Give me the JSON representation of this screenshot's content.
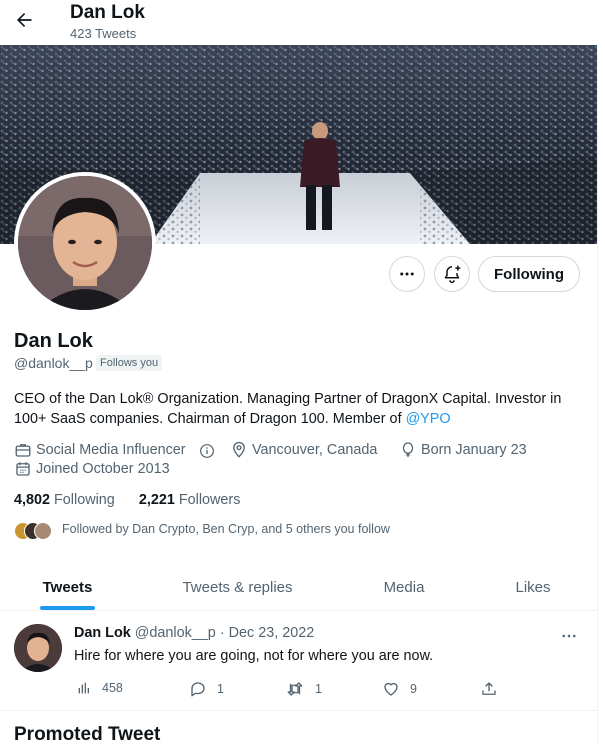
{
  "header": {
    "back_icon": "arrow-left-icon",
    "title": "Dan Lok",
    "tweet_count": "423 Tweets"
  },
  "profile": {
    "name": "Dan Lok",
    "handle": "@danlok__p",
    "follows_you": "Follows you",
    "bio_text": "CEO of the Dan Lok® Organization. Managing Partner of DragonX Capital. Investor in 100+ SaaS companies. Chairman of Dragon 100. Member of ",
    "bio_mention": "@YPO",
    "category": "Social Media Influencer",
    "location": "Vancouver, Canada",
    "born": "Born January 23",
    "joined": "Joined October 2013",
    "following_count": "4,802",
    "following_label": "Following",
    "followers_count": "2,221",
    "followers_label": "Followers",
    "followed_by": "Followed by Dan Crypto, Ben Cryp, and 5 others you follow"
  },
  "actions": {
    "more_icon": "more-horizontal-icon",
    "notify_icon": "bell-plus-icon",
    "following_label": "Following"
  },
  "tabs": [
    {
      "label": "Tweets",
      "active": true
    },
    {
      "label": "Tweets & replies",
      "active": false
    },
    {
      "label": "Media",
      "active": false
    },
    {
      "label": "Likes",
      "active": false
    }
  ],
  "tweet": {
    "author": "Dan Lok",
    "handle": "@danlok__p",
    "sep": "·",
    "date": "Dec 23, 2022",
    "text": "Hire for where you are going, not for where you are now.",
    "views": "458",
    "replies": "1",
    "retweets": "1",
    "likes": "9"
  },
  "promoted_title": "Promoted Tweet",
  "colors": {
    "accent": "#1d9bf0",
    "text": "#0f1419",
    "muted": "#536471",
    "border": "#cfd9de"
  }
}
